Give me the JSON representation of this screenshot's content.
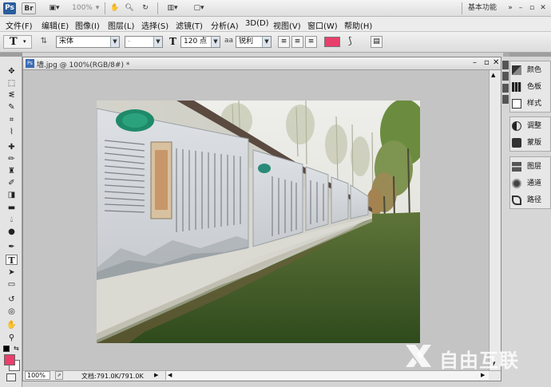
{
  "appbar": {
    "logo": "Ps",
    "br": "Br",
    "zoom": "100%",
    "workspace": "基本功能"
  },
  "menu": [
    "文件(F)",
    "编辑(E)",
    "图像(I)",
    "图层(L)",
    "选择(S)",
    "滤镜(T)",
    "分析(A)",
    "3D(D)",
    "视图(V)",
    "窗口(W)",
    "帮助(H)"
  ],
  "options": {
    "tool_glyph": "T",
    "font_family": "宋体",
    "font_style": "-",
    "font_size": "120 点",
    "aa_label": "aa",
    "antialias": "锐利",
    "text_color": "#e83f6b"
  },
  "document": {
    "tab_label": "墙.jpg @ 100%(RGB/8#) *",
    "zoom_value": "100%",
    "doc_info": "文档:791.0K/791.0K"
  },
  "panels": [
    {
      "icon": "color-icon",
      "label": "颜色"
    },
    {
      "icon": "swatches-icon",
      "label": "色板"
    },
    {
      "icon": "styles-icon",
      "label": "样式"
    },
    {
      "icon": "adjustments-icon",
      "label": "调整"
    },
    {
      "icon": "masks-icon",
      "label": "蒙版"
    },
    {
      "icon": "layers-icon",
      "label": "图层"
    },
    {
      "icon": "channels-icon",
      "label": "通道"
    },
    {
      "icon": "paths-icon",
      "label": "路径"
    }
  ],
  "colors": {
    "foreground": "#e83f6b",
    "background": "#ffffff"
  },
  "watermark": "自由互联"
}
